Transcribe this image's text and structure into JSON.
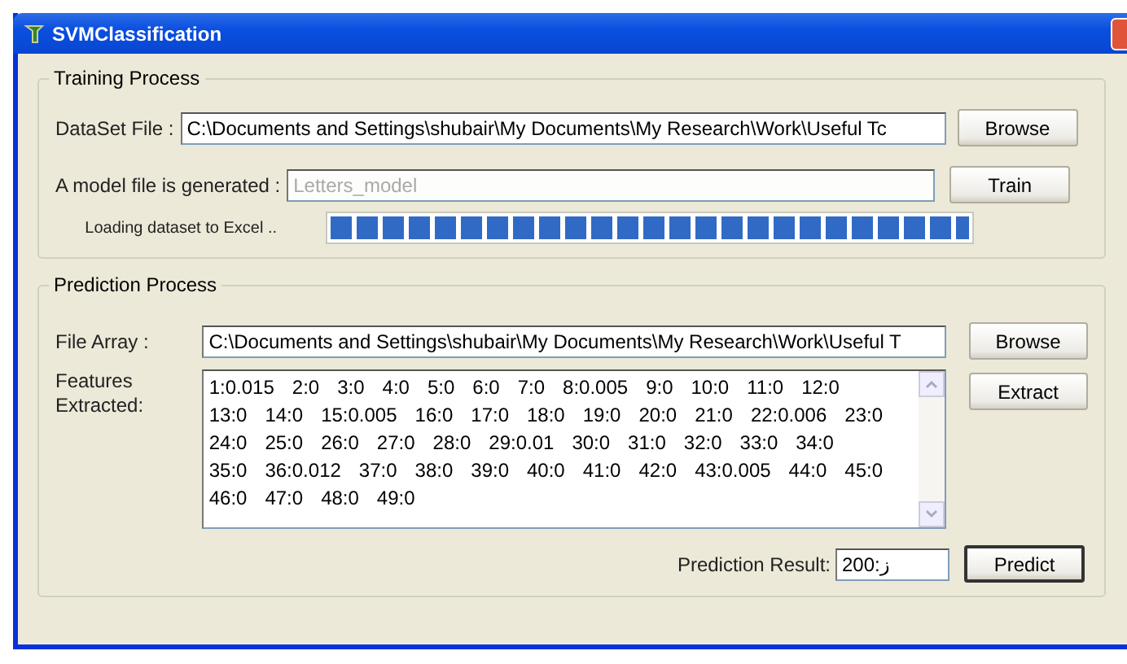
{
  "window": {
    "title": "SVMClassification"
  },
  "training": {
    "title": "Training Process",
    "dataset_label": "DataSet File :",
    "dataset_value": "C:\\Documents and Settings\\shubair\\My Documents\\My Research\\Work\\Useful Tc",
    "browse": "Browse",
    "model_label": "A model file is generated :",
    "model_value": "Letters_model",
    "model_disabled": true,
    "train": "Train",
    "progress_label": "Loading dataset to Excel ..",
    "progress": {
      "level": 1
    }
  },
  "prediction": {
    "title": "Prediction Process",
    "file_label": "File Array :",
    "file_value": "C:\\Documents and Settings\\shubair\\My Documents\\My Research\\Work\\Useful T",
    "browse": "Browse",
    "features_label": "Features Extracted:",
    "extract": "Extract",
    "features": [
      [
        "1:0.015",
        "2:0",
        "3:0",
        "4:0",
        "5:0",
        "6:0",
        "7:0",
        "8:0.005",
        "9:0",
        "10:0",
        "11:0",
        "12:0"
      ],
      [
        "13:0",
        "14:0",
        "15:0.005",
        "16:0",
        "17:0",
        "18:0",
        "19:0",
        "20:0",
        "21:0",
        "22:0.006",
        "23:0"
      ],
      [
        "24:0",
        "25:0",
        "26:0",
        "27:0",
        "28:0",
        "29:0.01",
        "30:0",
        "31:0",
        "32:0",
        "33:0",
        "34:0"
      ],
      [
        "35:0",
        "36:0.012",
        "37:0",
        "38:0",
        "39:0",
        "40:0",
        "41:0",
        "42:0",
        "43:0.005",
        "44:0",
        "45:0"
      ],
      [
        "46:0",
        "47:0",
        "48:0",
        "49:0"
      ]
    ],
    "result_label": "Prediction Result:",
    "result_value": "200:ز",
    "predict": "Predict",
    "predict_default": true
  }
}
